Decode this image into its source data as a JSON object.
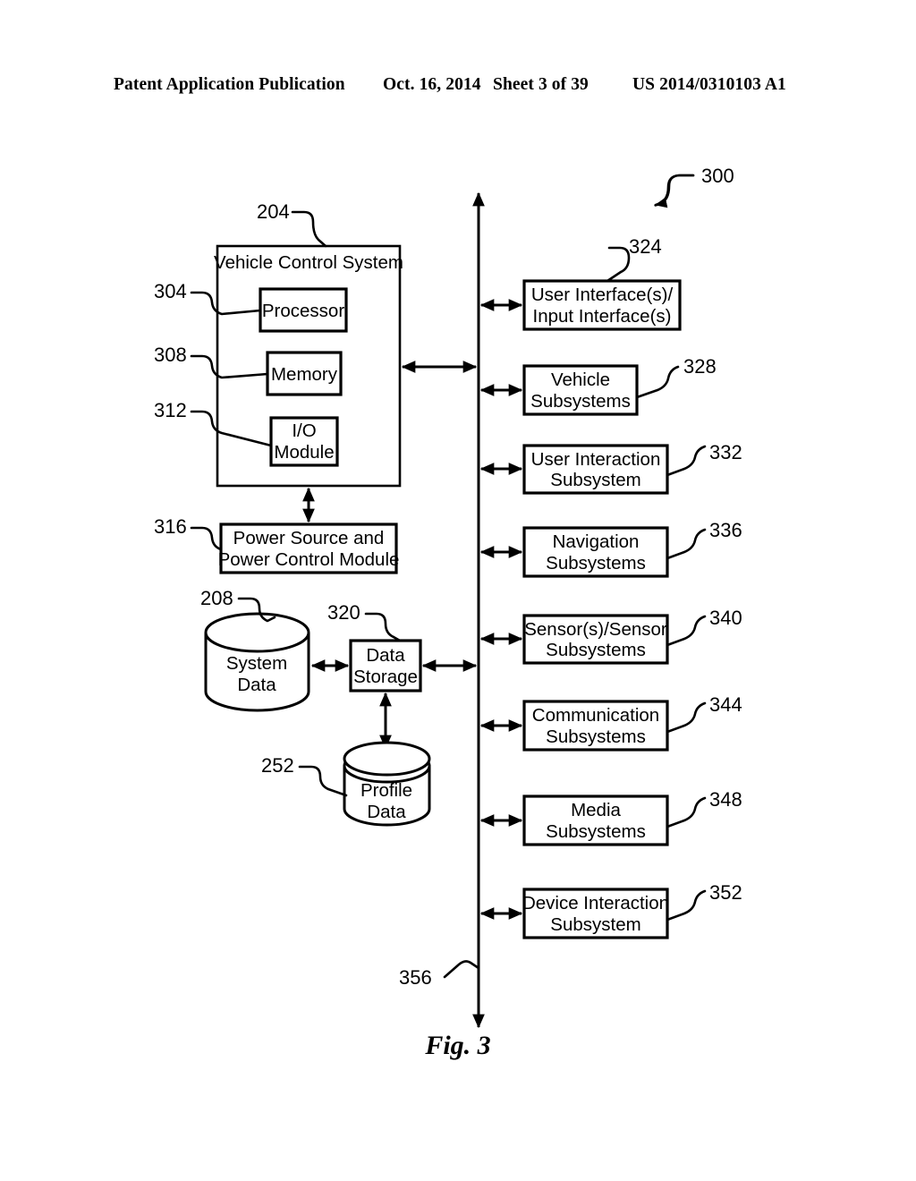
{
  "header": {
    "left": "Patent Application Publication",
    "date": "Oct. 16, 2014",
    "sheet": "Sheet 3 of 39",
    "patent_number": "US 2014/0310103 A1"
  },
  "figure": {
    "caption": "Fig. 3",
    "system_ref": "300",
    "bus_ref": "356"
  },
  "control_system": {
    "ref": "204",
    "title": "Vehicle Control System",
    "components": [
      {
        "ref": "304",
        "label": "Processor"
      },
      {
        "ref": "308",
        "label": "Memory"
      },
      {
        "ref": "312",
        "label": "I/O",
        "label2": "Module"
      }
    ]
  },
  "power": {
    "ref": "316",
    "line1": "Power Source and",
    "line2": "Power Control Module"
  },
  "storage": {
    "system_data": {
      "ref": "208",
      "line1": "System",
      "line2": "Data"
    },
    "data_storage": {
      "ref": "320",
      "line1": "Data",
      "line2": "Storage"
    },
    "profile_data": {
      "ref": "252",
      "line1": "Profile",
      "line2": "Data"
    }
  },
  "subsystems": [
    {
      "ref": "324",
      "line1": "User Interface(s)/",
      "line2": "Input Interface(s)",
      "ref_side": "top"
    },
    {
      "ref": "328",
      "line1": "Vehicle",
      "line2": "Subsystems",
      "ref_side": "right"
    },
    {
      "ref": "332",
      "line1": "User Interaction",
      "line2": "Subsystem",
      "ref_side": "right"
    },
    {
      "ref": "336",
      "line1": "Navigation",
      "line2": "Subsystems",
      "ref_side": "right"
    },
    {
      "ref": "340",
      "line1": "Sensor(s)/Sensor",
      "line2": "Subsystems",
      "ref_side": "right"
    },
    {
      "ref": "344",
      "line1": "Communication",
      "line2": "Subsystems",
      "ref_side": "right"
    },
    {
      "ref": "348",
      "line1": "Media",
      "line2": "Subsystems",
      "ref_side": "right"
    },
    {
      "ref": "352",
      "line1": "Device Interaction",
      "line2": "Subsystem",
      "ref_side": "right"
    }
  ]
}
